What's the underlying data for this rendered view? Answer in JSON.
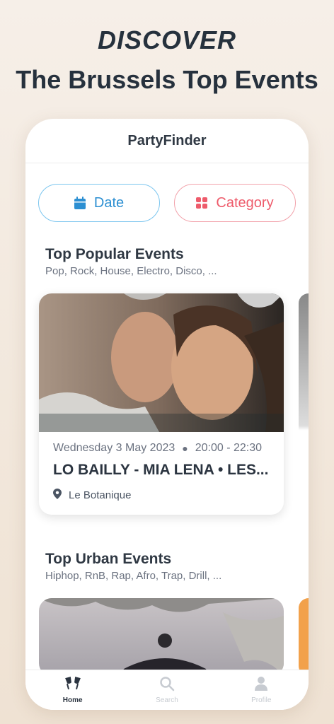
{
  "hero": {
    "line1": "DISCOVER",
    "line2": "The Brussels Top Events"
  },
  "app": {
    "title": "PartyFinder"
  },
  "filters": {
    "date_label": "Date",
    "category_label": "Category"
  },
  "sections": [
    {
      "title": "Top Popular Events",
      "subtitle": "Pop, Rock, House, Electro, Disco, ...",
      "card": {
        "date": "Wednesday 3 May 2023",
        "time": "20:00 - 22:30",
        "title": "LO BAILLY - MIA LENA • LES...",
        "venue": "Le Botanique"
      }
    },
    {
      "title": "Top Urban Events",
      "subtitle": "Hiphop, RnB, Rap, Afro, Trap, Drill, ..."
    }
  ],
  "tabs": [
    {
      "label": "Home",
      "icon": "cheers-icon",
      "active": true
    },
    {
      "label": "Search",
      "icon": "search-icon",
      "active": false
    },
    {
      "label": "Profile",
      "icon": "person-icon",
      "active": false
    }
  ],
  "colors": {
    "date_accent": "#2c8fd2",
    "category_accent": "#ee5b6b",
    "text": "#2b3440"
  }
}
